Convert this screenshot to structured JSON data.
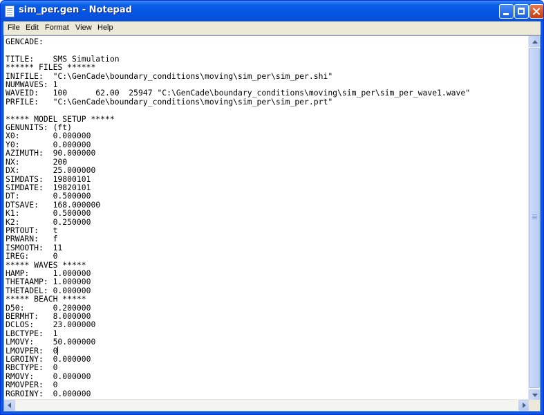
{
  "window": {
    "title": "sim_per.gen - Notepad",
    "icon": "notepad-icon",
    "controls": [
      "minimize-icon",
      "maximize-icon",
      "close-icon"
    ]
  },
  "menu": {
    "file": "File",
    "edit": "Edit",
    "format": "Format",
    "view": "View",
    "help": "Help"
  },
  "editor": {
    "lines_before_caret": [
      "GENCADE:",
      "",
      "TITLE:    SMS Simulation",
      "****** FILES ******",
      "INIFILE:  \"C:\\GenCade\\boundary_conditions\\moving\\sim_per\\sim_per.shi\"",
      "NUMWAVES: 1",
      "WAVEID:   100      62.00  25947 \"C:\\GenCade\\boundary_conditions\\moving\\sim_per\\sim_per_wave1.wave\"",
      "PRFILE:   \"C:\\GenCade\\boundary_conditions\\moving\\sim_per\\sim_per.prt\"",
      "",
      "***** MODEL SETUP *****",
      "GENUNITS: (ft)",
      "X0:       0.000000",
      "Y0:       0.000000",
      "AZIMUTH:  90.000000",
      "NX:       200",
      "DX:       25.000000",
      "SIMDATS:  19800101",
      "SIMDATE:  19820101",
      "DT:       0.500000",
      "DTSAVE:   168.000000",
      "K1:       0.500000",
      "K2:       0.250000",
      "PRTOUT:   t",
      "PRWARN:   f",
      "ISMOOTH:  11",
      "IREG:     0",
      "***** WAVES *****",
      "HAMP:     1.000000",
      "THETAAMP: 1.000000",
      "THETADEL: 0.000000",
      "***** BEACH *****",
      "D50:      0.200000",
      "BERMHT:   8.000000",
      "DCLOS:    23.000000",
      "LBCTYPE:  1",
      "LMOVY:    50.000000",
      "LMOVPER:  0"
    ],
    "lines_after_caret": [
      "LGROINY:  0.000000",
      "RBCTYPE:  0",
      "RMOVY:    0.000000",
      "RMOVPER:  0",
      "RGROINY:  0.000000"
    ]
  }
}
